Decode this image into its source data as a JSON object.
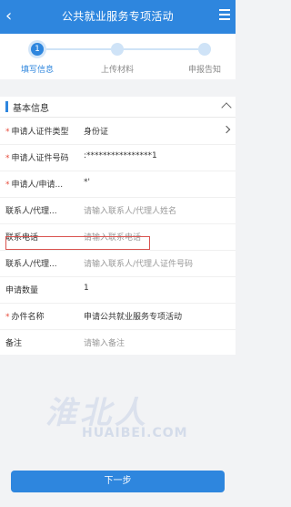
{
  "header": {
    "title": "公共就业服务专项活动"
  },
  "steps": [
    {
      "number": "1",
      "label": "填写信息",
      "active": true
    },
    {
      "label": "上传材料",
      "active": false
    },
    {
      "label": "申报告知",
      "active": false
    }
  ],
  "section": {
    "title": "基本信息"
  },
  "form": {
    "rows": [
      {
        "label": "申请人证件类型",
        "required": true,
        "value": "身份证"
      },
      {
        "label": "申请人证件号码",
        "required": true,
        "value": ":****************1"
      },
      {
        "label": "申请人/申请...",
        "required": true,
        "value": "*'"
      },
      {
        "label": "联系人/代理...",
        "required": false,
        "placeholder": "请输入联系人/代理人姓名"
      },
      {
        "label": "联系电话",
        "required": false,
        "placeholder": "请输入联系电话"
      },
      {
        "label": "联系人/代理...",
        "required": false,
        "placeholder": "请输入联系人/代理人证件号码"
      },
      {
        "label": "申请数量",
        "required": false,
        "value": "1"
      },
      {
        "label": "办件名称",
        "required": true,
        "value": "申请公共就业服务专项活动"
      },
      {
        "label": "备注",
        "required": false,
        "placeholder": "请输入备注"
      }
    ]
  },
  "watermark": {
    "cn": "淮北人",
    "en": "HUAIBEI.COM"
  },
  "footer": {
    "next_label": "下一步"
  },
  "colors": {
    "primary": "#2e86de",
    "required": "#e74c3c",
    "highlight": "#d9534f"
  }
}
